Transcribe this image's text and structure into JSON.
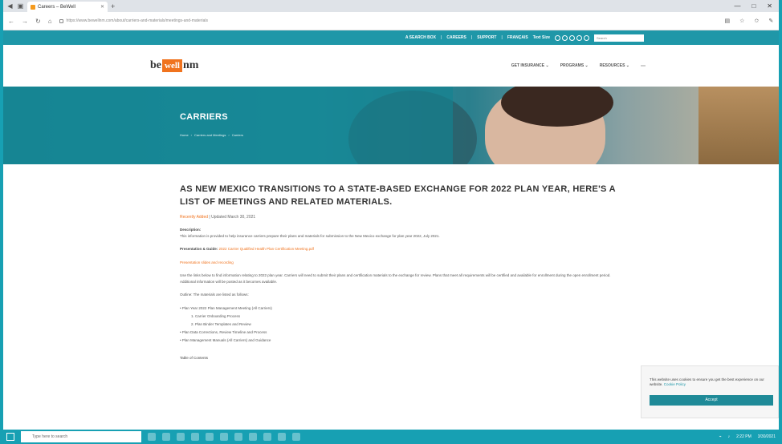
{
  "browser": {
    "tab_title": "Careers – BeWell",
    "url": "https://www.bewellnm.com/about/carriers-and-materials/meetings-and-materials",
    "new_tab": "+",
    "controls": [
      "—",
      "□",
      "✕"
    ]
  },
  "topstrip": {
    "links": [
      "A SEARCH BOX",
      "CAREERS",
      "SUPPORT",
      "FRANÇAIS"
    ],
    "text_size": "Text Size",
    "search_placeholder": "Search"
  },
  "site": {
    "logo_left": "be",
    "logo_mid": "well",
    "logo_right": "nm",
    "nav": [
      "GET INSURANCE ⌄",
      "PROGRAMS ⌄",
      "RESOURCES ⌄",
      "⋯"
    ]
  },
  "hero": {
    "title": "CARRIERS",
    "breadcrumbs": [
      "Home",
      "›",
      "Carriers and Meetings",
      "›",
      "Carriers"
    ]
  },
  "article": {
    "heading": "AS NEW MEXICO TRANSITIONS TO A STATE-BASED EXCHANGE FOR 2022 PLAN YEAR, HERE'S A LIST OF MEETINGS AND RELATED MATERIALS.",
    "meta": "Recently Added",
    "meta_sep": "|",
    "meta_rest": "Updated March 30, 2021",
    "p1_label": "Description:",
    "p1": "This information is provided to help insurance carriers prepare their plans and materials for submission to the New Mexico exchange for plan year 2022, July 2021.",
    "p2_label": "Presentation & Guide:",
    "p2_link": "2022 Carrier Qualified Health Plan Certification Meeting.pdf",
    "p3_link": "Presentation slides and recording",
    "p4": "Use the links below to find information relating to 2022 plan year. Carriers will need to submit their plans and certification materials to the exchange for review. Plans that meet all requirements will be certified and available for enrollment during the open enrollment period. Additional information will be posted as it becomes available.",
    "outline_label": "Outline: The materials are listed as follows:",
    "list": [
      "Plan Year 2022 Plan Management Meeting (All Carriers)",
      "Carrier Onboarding Process",
      "Plan Binder Templates and Review",
      "Plan Data Corrections, Review Timeline and Process",
      "Plan Management Manuals (All Carriers) and Guidance"
    ],
    "toc": "Table of Contents"
  },
  "cookie": {
    "text": "This website uses cookies to ensure you get the best experience on our website.",
    "link": "Cookie Policy",
    "accept": "Accept"
  },
  "taskbar": {
    "search": "Type here to search",
    "time": "2:22 PM",
    "date": "3/30/2021"
  }
}
